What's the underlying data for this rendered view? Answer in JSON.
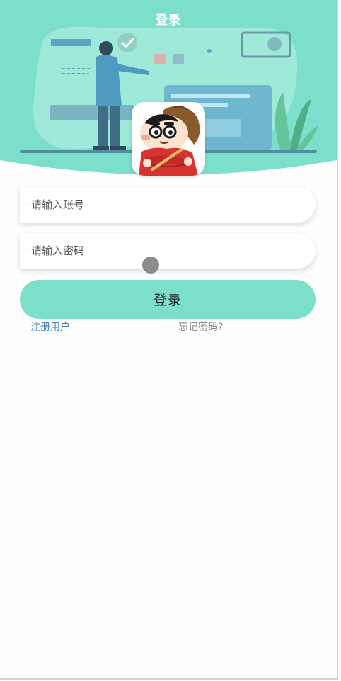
{
  "header": {
    "title": "登录",
    "background_color": "#7bdfcb",
    "illustration": "office-person-presentation-illustration"
  },
  "avatar": {
    "icon": "cartoon-boy-avatar"
  },
  "form": {
    "account_placeholder": "请输入账号",
    "account_value": "",
    "password_placeholder": "请输入密码",
    "password_value": ""
  },
  "actions": {
    "login_label": "登录",
    "register_label": "注册用户",
    "forgot_label": "忘记密码?"
  },
  "colors": {
    "accent": "#7bdfcb",
    "link": "#3f7fbf",
    "muted_text": "#8a8a8a"
  }
}
